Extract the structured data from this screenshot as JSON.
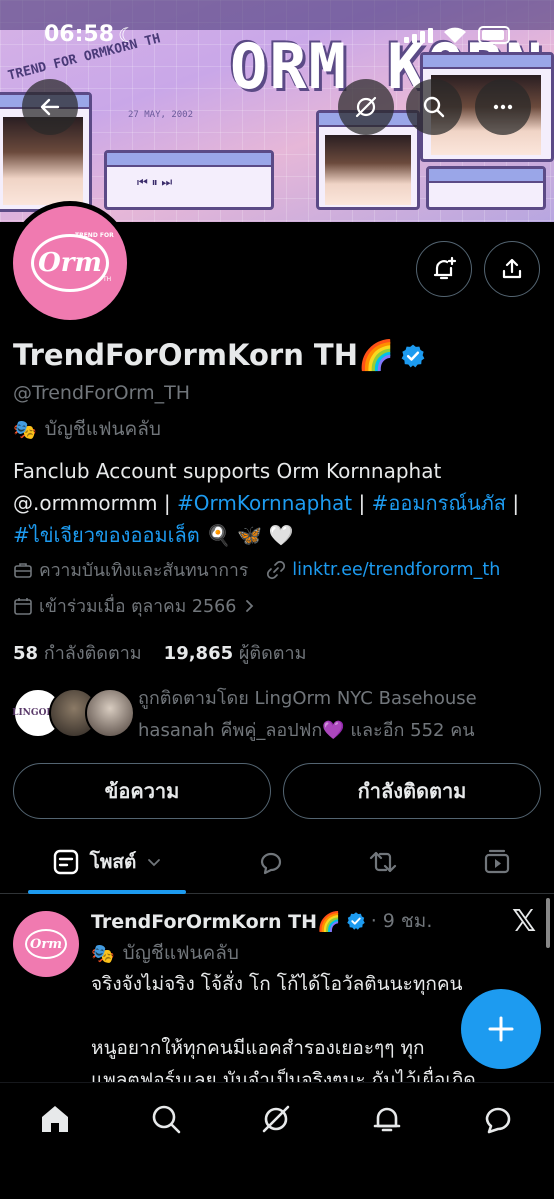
{
  "status_bar": {
    "time": "06:58",
    "moon": "☾"
  },
  "banner": {
    "title": "ORM KORN",
    "small_text": "TREND FOR ORMKORN TH",
    "date": "27 MAY, 2002",
    "player_controls": "⏮ ⏸ ⏭"
  },
  "profile": {
    "avatar_logo": "Orm",
    "avatar_top": "TREND FOR",
    "avatar_th": "TH",
    "name": "TrendForOrmKorn TH🌈",
    "handle": "@TrendForOrm_TH",
    "affiliation": "บัญชีแฟนคลับ",
    "bio": {
      "line1": "Fanclub Account supports Orm Kornnaphat",
      "line2_prefix": "@.ormmormm | ",
      "hashtag1": "#OrmKornnaphat",
      "sep1": " | ",
      "hashtag2": "#ออมกรณ์นภัส",
      "sep2": " |",
      "hashtag3": "#ไข่เจียวของออมเล็ต",
      "emoji": " 🍳 🦋 🤍"
    },
    "category": "ความบันเทิงและสันทนาการ",
    "website": "linktr.ee/trendfororm_th",
    "joined": "เข้าร่วมเมื่อ ตุลาคม 2566",
    "following_count": "58",
    "following_label": "กำลังติดตาม",
    "followers_count": "19,865",
    "followers_label": "ผู้ติดตาม",
    "followed_by_line1": "ถูกติดตามโดย LingOrm NYC Basehouse",
    "followed_by_line2": "hasanah คีพคู่_ลอปฟก💜 และอีก 552 คน",
    "followed_avatar_label": "LINGORM"
  },
  "actions": {
    "message": "ข้อความ",
    "following": "กำลังติดตาม"
  },
  "tabs": {
    "posts": "โพสต์"
  },
  "post": {
    "avatar_logo": "Orm",
    "author": "TrendForOrmKorn TH🌈",
    "time": "· 9 ชม.",
    "affiliation": "บัญชีแฟนคลับ",
    "line1": "จริงจังไม่จริง โจ้สั่ง โก โก้ได้โอวัลตินนะทุกคน",
    "line2": "",
    "line3": "หนูอยากให้ทุกคนมีแอคสำรองเยอะๆๆ ทุก",
    "line4": "แพลตฟอร์มเลย มันจำเป็นจริงๆนะ กันไว้เผื่อเกิด"
  },
  "x_logo": "𝕏",
  "colors": {
    "accent": "#1d9bf0",
    "avatar_pink": "#f07ab0",
    "background": "#000000"
  }
}
